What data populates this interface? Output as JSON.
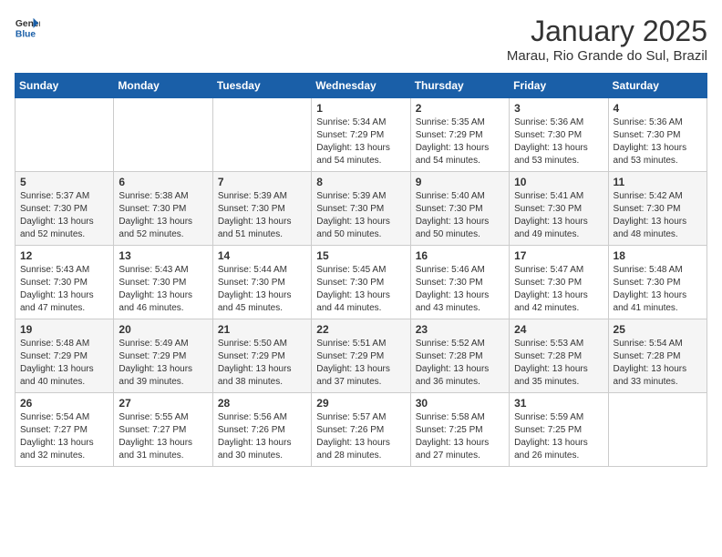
{
  "header": {
    "logo": {
      "general": "General",
      "blue": "Blue"
    },
    "title": "January 2025",
    "location": "Marau, Rio Grande do Sul, Brazil"
  },
  "days_of_week": [
    "Sunday",
    "Monday",
    "Tuesday",
    "Wednesday",
    "Thursday",
    "Friday",
    "Saturday"
  ],
  "weeks": [
    [
      {
        "day": "",
        "info": ""
      },
      {
        "day": "",
        "info": ""
      },
      {
        "day": "",
        "info": ""
      },
      {
        "day": "1",
        "info": "Sunrise: 5:34 AM\nSunset: 7:29 PM\nDaylight: 13 hours\nand 54 minutes."
      },
      {
        "day": "2",
        "info": "Sunrise: 5:35 AM\nSunset: 7:29 PM\nDaylight: 13 hours\nand 54 minutes."
      },
      {
        "day": "3",
        "info": "Sunrise: 5:36 AM\nSunset: 7:30 PM\nDaylight: 13 hours\nand 53 minutes."
      },
      {
        "day": "4",
        "info": "Sunrise: 5:36 AM\nSunset: 7:30 PM\nDaylight: 13 hours\nand 53 minutes."
      }
    ],
    [
      {
        "day": "5",
        "info": "Sunrise: 5:37 AM\nSunset: 7:30 PM\nDaylight: 13 hours\nand 52 minutes."
      },
      {
        "day": "6",
        "info": "Sunrise: 5:38 AM\nSunset: 7:30 PM\nDaylight: 13 hours\nand 52 minutes."
      },
      {
        "day": "7",
        "info": "Sunrise: 5:39 AM\nSunset: 7:30 PM\nDaylight: 13 hours\nand 51 minutes."
      },
      {
        "day": "8",
        "info": "Sunrise: 5:39 AM\nSunset: 7:30 PM\nDaylight: 13 hours\nand 50 minutes."
      },
      {
        "day": "9",
        "info": "Sunrise: 5:40 AM\nSunset: 7:30 PM\nDaylight: 13 hours\nand 50 minutes."
      },
      {
        "day": "10",
        "info": "Sunrise: 5:41 AM\nSunset: 7:30 PM\nDaylight: 13 hours\nand 49 minutes."
      },
      {
        "day": "11",
        "info": "Sunrise: 5:42 AM\nSunset: 7:30 PM\nDaylight: 13 hours\nand 48 minutes."
      }
    ],
    [
      {
        "day": "12",
        "info": "Sunrise: 5:43 AM\nSunset: 7:30 PM\nDaylight: 13 hours\nand 47 minutes."
      },
      {
        "day": "13",
        "info": "Sunrise: 5:43 AM\nSunset: 7:30 PM\nDaylight: 13 hours\nand 46 minutes."
      },
      {
        "day": "14",
        "info": "Sunrise: 5:44 AM\nSunset: 7:30 PM\nDaylight: 13 hours\nand 45 minutes."
      },
      {
        "day": "15",
        "info": "Sunrise: 5:45 AM\nSunset: 7:30 PM\nDaylight: 13 hours\nand 44 minutes."
      },
      {
        "day": "16",
        "info": "Sunrise: 5:46 AM\nSunset: 7:30 PM\nDaylight: 13 hours\nand 43 minutes."
      },
      {
        "day": "17",
        "info": "Sunrise: 5:47 AM\nSunset: 7:30 PM\nDaylight: 13 hours\nand 42 minutes."
      },
      {
        "day": "18",
        "info": "Sunrise: 5:48 AM\nSunset: 7:30 PM\nDaylight: 13 hours\nand 41 minutes."
      }
    ],
    [
      {
        "day": "19",
        "info": "Sunrise: 5:48 AM\nSunset: 7:29 PM\nDaylight: 13 hours\nand 40 minutes."
      },
      {
        "day": "20",
        "info": "Sunrise: 5:49 AM\nSunset: 7:29 PM\nDaylight: 13 hours\nand 39 minutes."
      },
      {
        "day": "21",
        "info": "Sunrise: 5:50 AM\nSunset: 7:29 PM\nDaylight: 13 hours\nand 38 minutes."
      },
      {
        "day": "22",
        "info": "Sunrise: 5:51 AM\nSunset: 7:29 PM\nDaylight: 13 hours\nand 37 minutes."
      },
      {
        "day": "23",
        "info": "Sunrise: 5:52 AM\nSunset: 7:28 PM\nDaylight: 13 hours\nand 36 minutes."
      },
      {
        "day": "24",
        "info": "Sunrise: 5:53 AM\nSunset: 7:28 PM\nDaylight: 13 hours\nand 35 minutes."
      },
      {
        "day": "25",
        "info": "Sunrise: 5:54 AM\nSunset: 7:28 PM\nDaylight: 13 hours\nand 33 minutes."
      }
    ],
    [
      {
        "day": "26",
        "info": "Sunrise: 5:54 AM\nSunset: 7:27 PM\nDaylight: 13 hours\nand 32 minutes."
      },
      {
        "day": "27",
        "info": "Sunrise: 5:55 AM\nSunset: 7:27 PM\nDaylight: 13 hours\nand 31 minutes."
      },
      {
        "day": "28",
        "info": "Sunrise: 5:56 AM\nSunset: 7:26 PM\nDaylight: 13 hours\nand 30 minutes."
      },
      {
        "day": "29",
        "info": "Sunrise: 5:57 AM\nSunset: 7:26 PM\nDaylight: 13 hours\nand 28 minutes."
      },
      {
        "day": "30",
        "info": "Sunrise: 5:58 AM\nSunset: 7:25 PM\nDaylight: 13 hours\nand 27 minutes."
      },
      {
        "day": "31",
        "info": "Sunrise: 5:59 AM\nSunset: 7:25 PM\nDaylight: 13 hours\nand 26 minutes."
      },
      {
        "day": "",
        "info": ""
      }
    ]
  ]
}
